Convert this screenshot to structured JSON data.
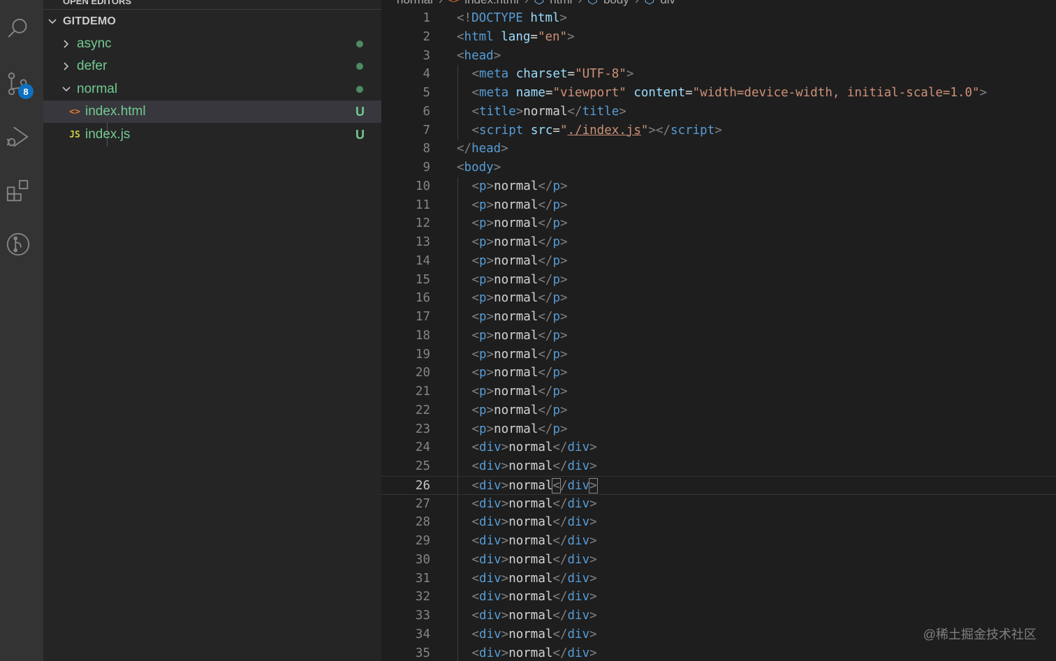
{
  "activity_bar": {
    "items": [
      {
        "name": "search"
      },
      {
        "name": "source-control",
        "badge": "8"
      },
      {
        "name": "run-and-debug"
      },
      {
        "name": "extensions"
      },
      {
        "name": "git-graph"
      }
    ]
  },
  "sidebar": {
    "partial_header": "OPEN EDITORS",
    "section_title": "GITDEMO",
    "tree": [
      {
        "label": "async",
        "type": "folder",
        "expanded": false,
        "status": "dot"
      },
      {
        "label": "defer",
        "type": "folder",
        "expanded": false,
        "status": "dot"
      },
      {
        "label": "normal",
        "type": "folder",
        "expanded": true,
        "status": "dot"
      },
      {
        "label": "index.html",
        "type": "file",
        "icon": "<>",
        "status": "U",
        "selected": true
      },
      {
        "label": "index.js",
        "type": "file",
        "icon": "JS",
        "status": "U"
      }
    ]
  },
  "breadcrumb": [
    "normal",
    "index.html",
    "html",
    "body",
    "div"
  ],
  "editor": {
    "cursor_line": 26,
    "lines": [
      {
        "n": "1",
        "indent": 0,
        "tokens": [
          [
            "punc",
            "<!"
          ],
          [
            "tag",
            "DOCTYPE"
          ],
          [
            "text",
            " "
          ],
          [
            "attr",
            "html"
          ],
          [
            "punc",
            ">"
          ]
        ]
      },
      {
        "n": "2",
        "indent": 0,
        "tokens": [
          [
            "punc",
            "<"
          ],
          [
            "tag",
            "html"
          ],
          [
            "text",
            " "
          ],
          [
            "attr",
            "lang"
          ],
          [
            "text",
            "="
          ],
          [
            "str",
            "\"en\""
          ],
          [
            "punc",
            ">"
          ]
        ]
      },
      {
        "n": "3",
        "indent": 0,
        "tokens": [
          [
            "punc",
            "<"
          ],
          [
            "tag",
            "head"
          ],
          [
            "punc",
            ">"
          ]
        ]
      },
      {
        "n": "4",
        "indent": 1,
        "tokens": [
          [
            "punc",
            "<"
          ],
          [
            "tag",
            "meta"
          ],
          [
            "text",
            " "
          ],
          [
            "attr",
            "charset"
          ],
          [
            "text",
            "="
          ],
          [
            "str",
            "\"UTF-8\""
          ],
          [
            "punc",
            ">"
          ]
        ]
      },
      {
        "n": "5",
        "indent": 1,
        "tokens": [
          [
            "punc",
            "<"
          ],
          [
            "tag",
            "meta"
          ],
          [
            "text",
            " "
          ],
          [
            "attr",
            "name"
          ],
          [
            "text",
            "="
          ],
          [
            "str",
            "\"viewport\""
          ],
          [
            "text",
            " "
          ],
          [
            "attr",
            "content"
          ],
          [
            "text",
            "="
          ],
          [
            "str",
            "\"width=device-width, initial-scale=1.0\""
          ],
          [
            "punc",
            ">"
          ]
        ]
      },
      {
        "n": "6",
        "indent": 1,
        "tokens": [
          [
            "punc",
            "<"
          ],
          [
            "tag",
            "title"
          ],
          [
            "punc",
            ">"
          ],
          [
            "text",
            "normal"
          ],
          [
            "punc",
            "</"
          ],
          [
            "tag",
            "title"
          ],
          [
            "punc",
            ">"
          ]
        ]
      },
      {
        "n": "7",
        "indent": 1,
        "tokens": [
          [
            "punc",
            "<"
          ],
          [
            "tag",
            "script"
          ],
          [
            "text",
            " "
          ],
          [
            "attr",
            "src"
          ],
          [
            "text",
            "="
          ],
          [
            "str",
            "\""
          ],
          [
            "link",
            "./index.js"
          ],
          [
            "str",
            "\""
          ],
          [
            "punc",
            "></"
          ],
          [
            "tag",
            "script"
          ],
          [
            "punc",
            ">"
          ]
        ]
      },
      {
        "n": "8",
        "indent": 0,
        "tokens": [
          [
            "punc",
            "</"
          ],
          [
            "tag",
            "head"
          ],
          [
            "punc",
            ">"
          ]
        ]
      },
      {
        "n": "9",
        "indent": 0,
        "tokens": [
          [
            "punc",
            "<"
          ],
          [
            "tag",
            "body"
          ],
          [
            "punc",
            ">"
          ]
        ]
      },
      {
        "n": "10",
        "indent": 1,
        "tokens": [
          [
            "punc",
            "<"
          ],
          [
            "tag",
            "p"
          ],
          [
            "punc",
            ">"
          ],
          [
            "text",
            "normal"
          ],
          [
            "punc",
            "</"
          ],
          [
            "tag",
            "p"
          ],
          [
            "punc",
            ">"
          ]
        ]
      },
      {
        "n": "11",
        "indent": 1,
        "tokens": [
          [
            "punc",
            "<"
          ],
          [
            "tag",
            "p"
          ],
          [
            "punc",
            ">"
          ],
          [
            "text",
            "normal"
          ],
          [
            "punc",
            "</"
          ],
          [
            "tag",
            "p"
          ],
          [
            "punc",
            ">"
          ]
        ]
      },
      {
        "n": "12",
        "indent": 1,
        "tokens": [
          [
            "punc",
            "<"
          ],
          [
            "tag",
            "p"
          ],
          [
            "punc",
            ">"
          ],
          [
            "text",
            "normal"
          ],
          [
            "punc",
            "</"
          ],
          [
            "tag",
            "p"
          ],
          [
            "punc",
            ">"
          ]
        ]
      },
      {
        "n": "13",
        "indent": 1,
        "tokens": [
          [
            "punc",
            "<"
          ],
          [
            "tag",
            "p"
          ],
          [
            "punc",
            ">"
          ],
          [
            "text",
            "normal"
          ],
          [
            "punc",
            "</"
          ],
          [
            "tag",
            "p"
          ],
          [
            "punc",
            ">"
          ]
        ]
      },
      {
        "n": "14",
        "indent": 1,
        "tokens": [
          [
            "punc",
            "<"
          ],
          [
            "tag",
            "p"
          ],
          [
            "punc",
            ">"
          ],
          [
            "text",
            "normal"
          ],
          [
            "punc",
            "</"
          ],
          [
            "tag",
            "p"
          ],
          [
            "punc",
            ">"
          ]
        ]
      },
      {
        "n": "15",
        "indent": 1,
        "tokens": [
          [
            "punc",
            "<"
          ],
          [
            "tag",
            "p"
          ],
          [
            "punc",
            ">"
          ],
          [
            "text",
            "normal"
          ],
          [
            "punc",
            "</"
          ],
          [
            "tag",
            "p"
          ],
          [
            "punc",
            ">"
          ]
        ]
      },
      {
        "n": "16",
        "indent": 1,
        "tokens": [
          [
            "punc",
            "<"
          ],
          [
            "tag",
            "p"
          ],
          [
            "punc",
            ">"
          ],
          [
            "text",
            "normal"
          ],
          [
            "punc",
            "</"
          ],
          [
            "tag",
            "p"
          ],
          [
            "punc",
            ">"
          ]
        ]
      },
      {
        "n": "17",
        "indent": 1,
        "tokens": [
          [
            "punc",
            "<"
          ],
          [
            "tag",
            "p"
          ],
          [
            "punc",
            ">"
          ],
          [
            "text",
            "normal"
          ],
          [
            "punc",
            "</"
          ],
          [
            "tag",
            "p"
          ],
          [
            "punc",
            ">"
          ]
        ]
      },
      {
        "n": "18",
        "indent": 1,
        "tokens": [
          [
            "punc",
            "<"
          ],
          [
            "tag",
            "p"
          ],
          [
            "punc",
            ">"
          ],
          [
            "text",
            "normal"
          ],
          [
            "punc",
            "</"
          ],
          [
            "tag",
            "p"
          ],
          [
            "punc",
            ">"
          ]
        ]
      },
      {
        "n": "19",
        "indent": 1,
        "tokens": [
          [
            "punc",
            "<"
          ],
          [
            "tag",
            "p"
          ],
          [
            "punc",
            ">"
          ],
          [
            "text",
            "normal"
          ],
          [
            "punc",
            "</"
          ],
          [
            "tag",
            "p"
          ],
          [
            "punc",
            ">"
          ]
        ]
      },
      {
        "n": "20",
        "indent": 1,
        "tokens": [
          [
            "punc",
            "<"
          ],
          [
            "tag",
            "p"
          ],
          [
            "punc",
            ">"
          ],
          [
            "text",
            "normal"
          ],
          [
            "punc",
            "</"
          ],
          [
            "tag",
            "p"
          ],
          [
            "punc",
            ">"
          ]
        ]
      },
      {
        "n": "21",
        "indent": 1,
        "tokens": [
          [
            "punc",
            "<"
          ],
          [
            "tag",
            "p"
          ],
          [
            "punc",
            ">"
          ],
          [
            "text",
            "normal"
          ],
          [
            "punc",
            "</"
          ],
          [
            "tag",
            "p"
          ],
          [
            "punc",
            ">"
          ]
        ]
      },
      {
        "n": "22",
        "indent": 1,
        "tokens": [
          [
            "punc",
            "<"
          ],
          [
            "tag",
            "p"
          ],
          [
            "punc",
            ">"
          ],
          [
            "text",
            "normal"
          ],
          [
            "punc",
            "</"
          ],
          [
            "tag",
            "p"
          ],
          [
            "punc",
            ">"
          ]
        ]
      },
      {
        "n": "23",
        "indent": 1,
        "tokens": [
          [
            "punc",
            "<"
          ],
          [
            "tag",
            "p"
          ],
          [
            "punc",
            ">"
          ],
          [
            "text",
            "normal"
          ],
          [
            "punc",
            "</"
          ],
          [
            "tag",
            "p"
          ],
          [
            "punc",
            ">"
          ]
        ]
      },
      {
        "n": "24",
        "indent": 1,
        "tokens": [
          [
            "punc",
            "<"
          ],
          [
            "tag",
            "div"
          ],
          [
            "punc",
            ">"
          ],
          [
            "text",
            "normal"
          ],
          [
            "punc",
            "</"
          ],
          [
            "tag",
            "div"
          ],
          [
            "punc",
            ">"
          ]
        ]
      },
      {
        "n": "25",
        "indent": 1,
        "tokens": [
          [
            "punc",
            "<"
          ],
          [
            "tag",
            "div"
          ],
          [
            "punc",
            ">"
          ],
          [
            "text",
            "normal"
          ],
          [
            "punc",
            "</"
          ],
          [
            "tag",
            "div"
          ],
          [
            "punc",
            ">"
          ]
        ]
      },
      {
        "n": "26",
        "indent": 1,
        "tokens": [
          [
            "punc",
            "<"
          ],
          [
            "tag",
            "div"
          ],
          [
            "punc",
            ">"
          ],
          [
            "text",
            "normal"
          ],
          [
            "boxpunc",
            "<"
          ],
          [
            "punc",
            "/"
          ],
          [
            "tag",
            "div"
          ],
          [
            "boxpunc",
            ">"
          ]
        ]
      },
      {
        "n": "27",
        "indent": 1,
        "tokens": [
          [
            "punc",
            "<"
          ],
          [
            "tag",
            "div"
          ],
          [
            "punc",
            ">"
          ],
          [
            "text",
            "normal"
          ],
          [
            "punc",
            "</"
          ],
          [
            "tag",
            "div"
          ],
          [
            "punc",
            ">"
          ]
        ]
      },
      {
        "n": "28",
        "indent": 1,
        "tokens": [
          [
            "punc",
            "<"
          ],
          [
            "tag",
            "div"
          ],
          [
            "punc",
            ">"
          ],
          [
            "text",
            "normal"
          ],
          [
            "punc",
            "</"
          ],
          [
            "tag",
            "div"
          ],
          [
            "punc",
            ">"
          ]
        ]
      },
      {
        "n": "29",
        "indent": 1,
        "tokens": [
          [
            "punc",
            "<"
          ],
          [
            "tag",
            "div"
          ],
          [
            "punc",
            ">"
          ],
          [
            "text",
            "normal"
          ],
          [
            "punc",
            "</"
          ],
          [
            "tag",
            "div"
          ],
          [
            "punc",
            ">"
          ]
        ]
      },
      {
        "n": "30",
        "indent": 1,
        "tokens": [
          [
            "punc",
            "<"
          ],
          [
            "tag",
            "div"
          ],
          [
            "punc",
            ">"
          ],
          [
            "text",
            "normal"
          ],
          [
            "punc",
            "</"
          ],
          [
            "tag",
            "div"
          ],
          [
            "punc",
            ">"
          ]
        ]
      },
      {
        "n": "31",
        "indent": 1,
        "tokens": [
          [
            "punc",
            "<"
          ],
          [
            "tag",
            "div"
          ],
          [
            "punc",
            ">"
          ],
          [
            "text",
            "normal"
          ],
          [
            "punc",
            "</"
          ],
          [
            "tag",
            "div"
          ],
          [
            "punc",
            ">"
          ]
        ]
      },
      {
        "n": "32",
        "indent": 1,
        "tokens": [
          [
            "punc",
            "<"
          ],
          [
            "tag",
            "div"
          ],
          [
            "punc",
            ">"
          ],
          [
            "text",
            "normal"
          ],
          [
            "punc",
            "</"
          ],
          [
            "tag",
            "div"
          ],
          [
            "punc",
            ">"
          ]
        ]
      },
      {
        "n": "33",
        "indent": 1,
        "tokens": [
          [
            "punc",
            "<"
          ],
          [
            "tag",
            "div"
          ],
          [
            "punc",
            ">"
          ],
          [
            "text",
            "normal"
          ],
          [
            "punc",
            "</"
          ],
          [
            "tag",
            "div"
          ],
          [
            "punc",
            ">"
          ]
        ]
      },
      {
        "n": "34",
        "indent": 1,
        "tokens": [
          [
            "punc",
            "<"
          ],
          [
            "tag",
            "div"
          ],
          [
            "punc",
            ">"
          ],
          [
            "text",
            "normal"
          ],
          [
            "punc",
            "</"
          ],
          [
            "tag",
            "div"
          ],
          [
            "punc",
            ">"
          ]
        ]
      },
      {
        "n": "35",
        "indent": 1,
        "tokens": [
          [
            "punc",
            "<"
          ],
          [
            "tag",
            "div"
          ],
          [
            "punc",
            ">"
          ],
          [
            "text",
            "normal"
          ],
          [
            "punc",
            "</"
          ],
          [
            "tag",
            "div"
          ],
          [
            "punc",
            ">"
          ]
        ]
      }
    ]
  },
  "watermark": "@稀土掘金技术社区",
  "colors": {
    "tag": "#569cd6",
    "attr": "#9cdcfe",
    "string": "#ce9178",
    "punctuation": "#808080",
    "text": "#d4d4d4",
    "untracked": "#73c991",
    "badge": "#0e70c0"
  }
}
